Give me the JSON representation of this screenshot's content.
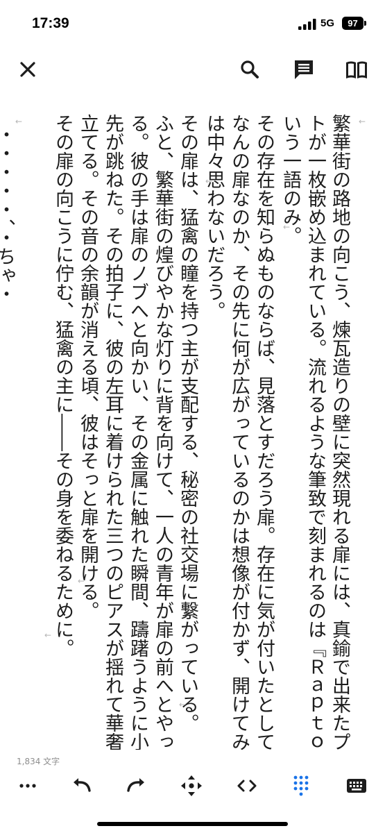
{
  "status": {
    "time": "17:39",
    "network": "5G",
    "battery": "97"
  },
  "toolbar": {
    "close_icon": "close-icon",
    "search_icon": "search-icon",
    "comment_icon": "comment-icon",
    "book_icon": "book-icon"
  },
  "editor": {
    "partial_line": "・・・・・、・ちゃ・",
    "lines": [
      "繁華街の路地の向こう、煉瓦造りの壁に突然現れる扉には、真鍮で出来たプレー",
      "トが一枚嵌め込まれている。流れるような筆致で刻まれるのは『Ｒａｐｔｏｒ』と",
      "いう一語のみ。",
      "その存在を知らぬものならば、見落とすだろう扉。存在に気が付いたとしても、",
      "なんの扉なのか、その先に何が広がっているのかは想像が付かず、開けてみようと",
      "は中々思わないだろう。",
      "その扉は、猛禽の瞳を持つ主が支配する、秘密の社交場に繋がっている。",
      "ふと、繁華街の煌びやかな灯りに背を向けて、一人の青年が扉の前へとやってく",
      "る。彼の手は扉のノブへと向かい、その金属に触れた瞬間、躊躇うように小さく指",
      "先が跳ねた。その拍子に、彼の左耳に着けられた三つのピアスが揺れて華奢な音を",
      "立てる。その音の余韻が消える頃、彼はそっと扉を開ける。",
      "その扉の向こうに佇む、猛禽の主に――その身を委ねるために。"
    ],
    "para_mark": "←"
  },
  "footer": {
    "char_count": "1,834 文字"
  },
  "bottom_toolbar": {
    "more_icon": "more-icon",
    "undo_icon": "undo-icon",
    "redo_icon": "redo-icon",
    "move_icon": "move-cursor-icon",
    "code_icon": "code-icon",
    "keypad_icon": "keypad-icon",
    "keyboard_icon": "keyboard-icon"
  },
  "colors": {
    "accent": "#1a73e8",
    "icon": "#1d1d1d",
    "mark": "#b5b5b5"
  }
}
